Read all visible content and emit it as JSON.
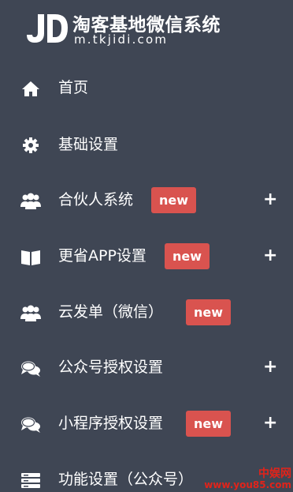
{
  "brand": {
    "logo_letters": "JD",
    "title": "淘客基地微信系统",
    "url": "m.tkjidi.com"
  },
  "menu": {
    "items": [
      {
        "label": "首页",
        "icon": "home-icon",
        "badge": "",
        "expandable": false
      },
      {
        "label": "基础设置",
        "icon": "gear-icon",
        "badge": "",
        "expandable": false
      },
      {
        "label": "合伙人系统",
        "icon": "users-icon",
        "badge": "new",
        "expandable": true
      },
      {
        "label": "更省APP设置",
        "icon": "book-icon",
        "badge": "new",
        "expandable": true
      },
      {
        "label": "云发单（微信）",
        "icon": "users-icon",
        "badge": "new",
        "expandable": false
      },
      {
        "label": "公众号授权设置",
        "icon": "chat-bubbles-icon",
        "badge": "",
        "expandable": true
      },
      {
        "label": "小程序授权设置",
        "icon": "chat-bubbles-icon",
        "badge": "new",
        "expandable": true
      },
      {
        "label": "功能设置（公众号）",
        "icon": "server-icon",
        "badge": "",
        "expandable": false
      }
    ],
    "expand_symbol": "+"
  },
  "watermark": {
    "cn": "中娱网",
    "url": "www.you85.com"
  },
  "colors": {
    "background": "#3f4654",
    "badge": "#d9534f",
    "text": "#ffffff",
    "watermark": "#e2231a"
  }
}
